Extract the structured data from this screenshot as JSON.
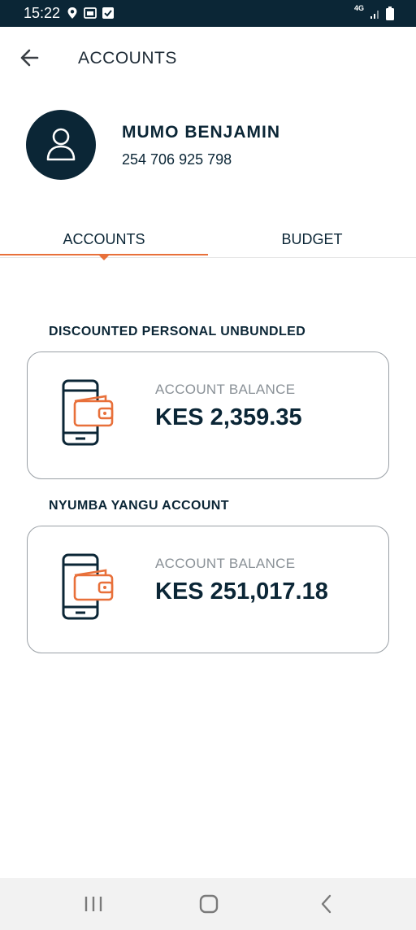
{
  "status_bar": {
    "time": "15:22",
    "network": "4G",
    "icons": [
      "location-pin-icon",
      "gallery-icon",
      "checkbox-icon",
      "signal-icon",
      "battery-icon"
    ]
  },
  "header": {
    "title": "ACCOUNTS",
    "back_icon": "arrow-left-icon"
  },
  "profile": {
    "name": "MUMO BENJAMIN",
    "phone": "254 706 925 798",
    "avatar_icon": "user-icon"
  },
  "tabs": [
    {
      "label": "ACCOUNTS",
      "active": true
    },
    {
      "label": "BUDGET",
      "active": false
    }
  ],
  "accounts": [
    {
      "name": "DISCOUNTED PERSONAL UNBUNDLED",
      "balance_label": "ACCOUNT BALANCE",
      "balance": "KES 2,359.35",
      "icon": "phone-wallet-icon"
    },
    {
      "name": "NYUMBA YANGU ACCOUNT",
      "balance_label": "ACCOUNT BALANCE",
      "balance": "KES 251,017.18",
      "icon": "phone-wallet-icon"
    }
  ],
  "nav_bar": {
    "buttons": [
      "recent-apps-icon",
      "home-icon",
      "back-icon"
    ]
  },
  "colors": {
    "primary": "#0b2636",
    "accent": "#e8703a",
    "muted": "#8a9197"
  }
}
